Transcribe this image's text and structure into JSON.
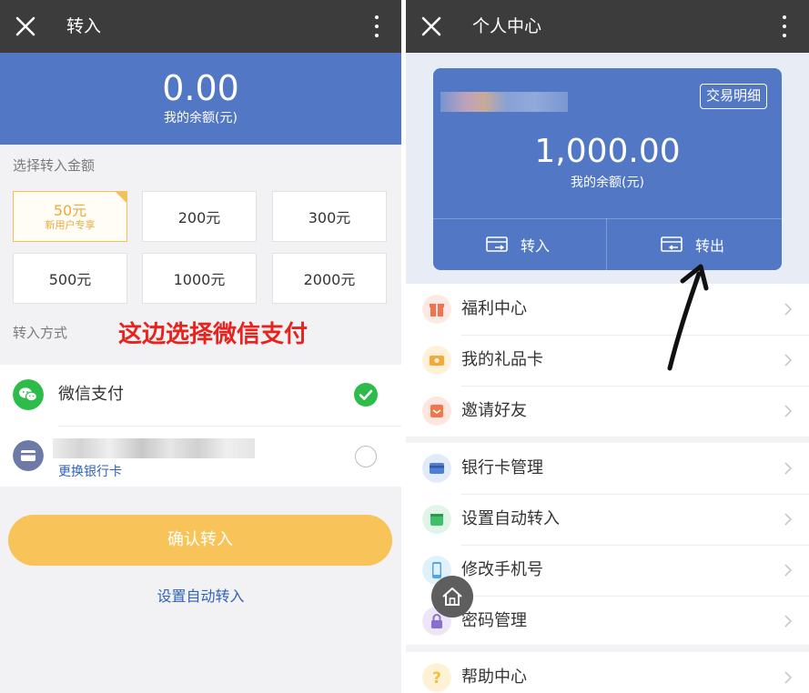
{
  "left": {
    "title": "转入",
    "balance": {
      "amount": "0.00",
      "caption": "我的余额(元)"
    },
    "amount_section_label": "选择转入金额",
    "amounts": [
      {
        "label": "50元",
        "sub": "新用户专享",
        "selected": true
      },
      {
        "label": "200元"
      },
      {
        "label": "300元"
      },
      {
        "label": "500元"
      },
      {
        "label": "1000元"
      },
      {
        "label": "2000元"
      }
    ],
    "method_label": "转入方式",
    "annotation": "这边选择微信支付",
    "methods": [
      {
        "label": "微信支付",
        "checked": true
      },
      {
        "link": "更换银行卡",
        "checked": false
      }
    ],
    "confirm_button": "确认转入",
    "auto_link": "设置自动转入"
  },
  "right": {
    "title": "个人中心",
    "card": {
      "detail_button": "交易明细",
      "amount": "1,000.00",
      "caption": "我的余额(元)",
      "actions": [
        "转入",
        "转出"
      ]
    },
    "menu_groups": [
      [
        {
          "label": "福利中心",
          "icon": "gift-icon",
          "color": "#f0724e"
        },
        {
          "label": "我的礼品卡",
          "icon": "gift-card-icon",
          "color": "#f5a93a"
        },
        {
          "label": "邀请好友",
          "icon": "invite-icon",
          "color": "#f2764c"
        }
      ],
      [
        {
          "label": "银行卡管理",
          "icon": "bank-card-icon",
          "color": "#4f7fd3"
        },
        {
          "label": "设置自动转入",
          "icon": "auto-transfer-icon",
          "color": "#3fbf6a"
        },
        {
          "label": "修改手机号",
          "icon": "phone-icon",
          "color": "#4fa6e6"
        },
        {
          "label": "密码管理",
          "icon": "lock-icon",
          "color": "#8a6fd1"
        }
      ],
      [
        {
          "label": "帮助中心",
          "icon": "help-icon",
          "color": "#f4bf3c"
        }
      ]
    ]
  },
  "colors": {
    "brand_blue": "#5278c5",
    "top_bar": "#3c3c3c",
    "confirm_yellow": "#f8c45a",
    "annotation_red": "#e8221c",
    "check_green": "#2dbb4a",
    "link_blue": "#2f62b8"
  }
}
